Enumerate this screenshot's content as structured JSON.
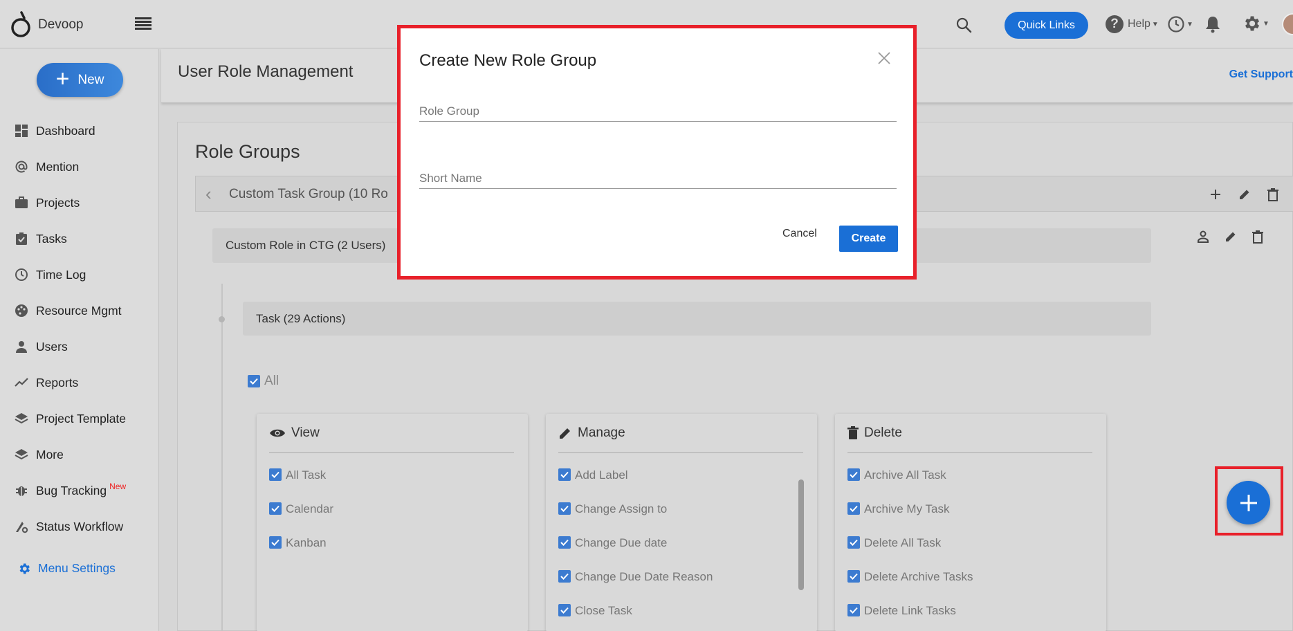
{
  "app": {
    "brand": "Devoop"
  },
  "topbar": {
    "quick_links": "Quick Links",
    "help": "Help"
  },
  "sidebar": {
    "new_label": "New",
    "items": [
      {
        "label": "Dashboard",
        "icon": "dashboard-icon"
      },
      {
        "label": "Mention",
        "icon": "at-icon"
      },
      {
        "label": "Projects",
        "icon": "briefcase-icon"
      },
      {
        "label": "Tasks",
        "icon": "clipboard-check-icon"
      },
      {
        "label": "Time Log",
        "icon": "clock-icon"
      },
      {
        "label": "Resource Mgmt",
        "icon": "palette-icon"
      },
      {
        "label": "Users",
        "icon": "user-icon"
      },
      {
        "label": "Reports",
        "icon": "trend-icon"
      },
      {
        "label": "Project Template",
        "icon": "layers-icon"
      },
      {
        "label": "More",
        "icon": "layers-icon"
      },
      {
        "label": "Bug Tracking",
        "icon": "bug-icon",
        "badge": "New"
      },
      {
        "label": "Status Workflow",
        "icon": "workflow-icon"
      }
    ],
    "menu_settings": "Menu Settings"
  },
  "header": {
    "title": "User Role Management",
    "get_support": "Get Support"
  },
  "main": {
    "section_title": "Role Groups",
    "group_label": "Custom Task Group   (10 Ro",
    "role_label": "Custom Role in CTG  (2 Users)",
    "task_label": "Task  (29 Actions)",
    "all_label": "All",
    "panels": [
      {
        "title": "View",
        "icon": "eye-icon",
        "items": [
          "All Task",
          "Calendar",
          "Kanban"
        ]
      },
      {
        "title": "Manage",
        "icon": "pencil-icon",
        "items": [
          "Add Label",
          "Change Assign to",
          "Change Due date",
          "Change Due Date Reason",
          "Close Task"
        ]
      },
      {
        "title": "Delete",
        "icon": "trash-icon",
        "items": [
          "Archive All Task",
          "Archive My Task",
          "Delete All Task",
          "Delete Archive Tasks",
          "Delete Link Tasks"
        ]
      }
    ]
  },
  "modal": {
    "title": "Create New Role Group",
    "role_group_placeholder": "Role Group",
    "short_name_placeholder": "Short Name",
    "cancel": "Cancel",
    "create": "Create"
  },
  "colors": {
    "accent": "#1a6fd6",
    "highlight": "#e8202a",
    "checkbox": "#3c7bd0",
    "new_badge": "#e22222"
  }
}
